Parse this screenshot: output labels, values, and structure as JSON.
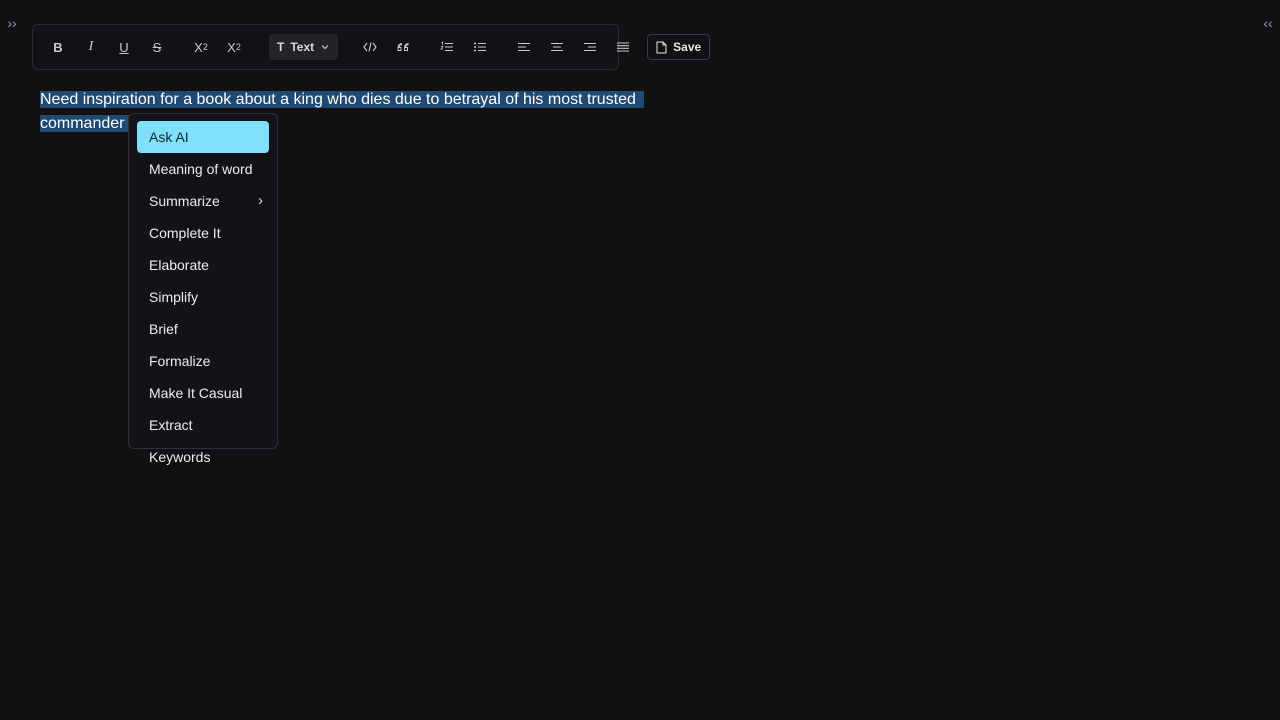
{
  "toggles": {
    "left": "››",
    "right": "‹‹"
  },
  "toolbar": {
    "bold": "B",
    "italic": "I",
    "underline": "U",
    "strike": "S",
    "superscript_base": "X",
    "superscript_exp": "2",
    "subscript_base": "X",
    "subscript_exp": "2",
    "text_select": "Text",
    "text_select_icon": "T",
    "save": "Save"
  },
  "editor": {
    "text": "Need inspiration for a book about a king who dies due to betrayal of his most trusted commander"
  },
  "context_menu": {
    "items": [
      {
        "label": "Ask AI"
      },
      {
        "label": "Meaning of word"
      },
      {
        "label": "Summarize"
      },
      {
        "label": "Complete It"
      },
      {
        "label": "Elaborate"
      },
      {
        "label": "Simplify"
      },
      {
        "label": "Brief"
      },
      {
        "label": "Formalize"
      },
      {
        "label": "Make It Casual"
      },
      {
        "label": "Extract Keywords"
      }
    ]
  },
  "colors": {
    "background": "#111114",
    "selection": "#1f4a73",
    "menu_active": "#7fe0fb"
  }
}
